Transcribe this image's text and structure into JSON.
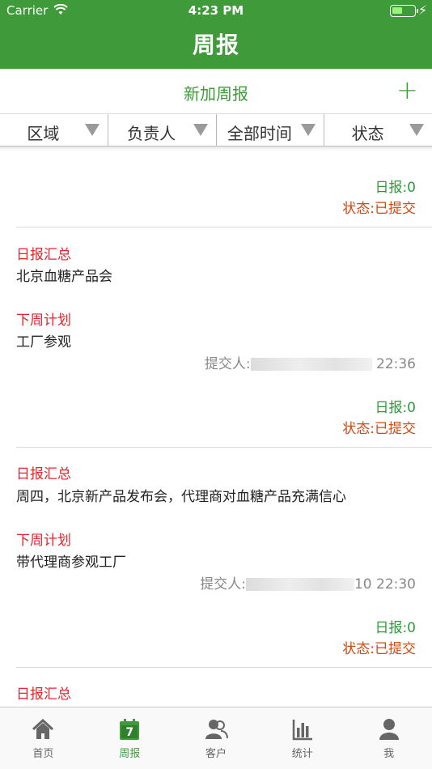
{
  "status_bar": {
    "carrier": "Carrier",
    "time": "4:23 PM"
  },
  "header": {
    "title": "周报"
  },
  "add_bar": {
    "label": "新加周报",
    "plus": "+"
  },
  "filters": [
    "区域",
    "负责人",
    "全部时间",
    "状态"
  ],
  "entries": [
    {
      "daily_count": "日报:0",
      "status": "状态:已提交"
    },
    {
      "summary_heading": "日报汇总",
      "summary": "北京血糖产品会",
      "plan_heading": "下周计划",
      "plan": "工厂参观",
      "submitter_label": "提交人:",
      "submitter_suffix": "22:36",
      "daily_count": "日报:0",
      "status": "状态:已提交"
    },
    {
      "summary_heading": "日报汇总",
      "summary": "周四，北京新产品发布会，代理商对血糖产品充满信心",
      "plan_heading": "下周计划",
      "plan": "带代理商参观工厂",
      "submitter_label": "提交人:",
      "submitter_suffix": "10 22:30",
      "daily_count": "日报:0",
      "status": "状态:已提交"
    },
    {
      "summary_heading": "日报汇总"
    }
  ],
  "tabs": [
    {
      "label": "首页",
      "icon": "home-icon"
    },
    {
      "label": "周报",
      "icon": "calendar-icon",
      "active": true,
      "badge": "7"
    },
    {
      "label": "客户",
      "icon": "customers-icon"
    },
    {
      "label": "统计",
      "icon": "stats-icon"
    },
    {
      "label": "我",
      "icon": "profile-icon"
    }
  ],
  "colors": {
    "brand_green": "#3f9a3a",
    "status_orange": "#d24a10",
    "heading_red": "#e8242c"
  }
}
